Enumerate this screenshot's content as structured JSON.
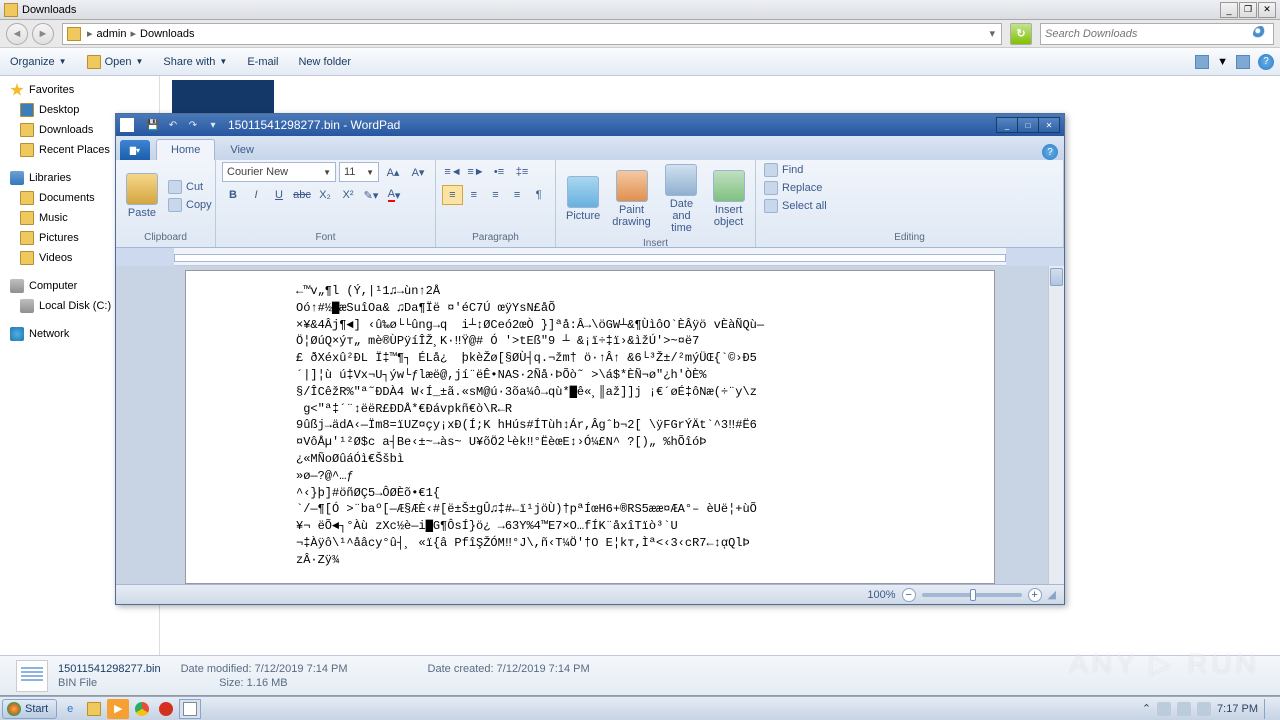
{
  "explorer": {
    "title": "Downloads",
    "breadcrumbs": [
      "admin",
      "Downloads"
    ],
    "search_placeholder": "Search Downloads",
    "toolbar": {
      "organize": "Organize",
      "open": "Open",
      "share": "Share with",
      "email": "E-mail",
      "newfolder": "New folder"
    },
    "sidebar": {
      "favorites": "Favorites",
      "desktop": "Desktop",
      "downloads": "Downloads",
      "recent": "Recent Places",
      "libraries": "Libraries",
      "documents": "Documents",
      "music": "Music",
      "pictures": "Pictures",
      "videos": "Videos",
      "computer": "Computer",
      "localdisk": "Local Disk (C:)",
      "network": "Network"
    },
    "details": {
      "filename": "15011541298277.bin",
      "filetype": "BIN File",
      "modified_label": "Date modified:",
      "modified": "7/12/2019 7:14 PM",
      "created_label": "Date created:",
      "created": "7/12/2019 7:14 PM",
      "size_label": "Size:",
      "size": "1.16 MB"
    }
  },
  "wordpad": {
    "title": "15011541298277.bin - WordPad",
    "tabs": {
      "home": "Home",
      "view": "View"
    },
    "ribbon": {
      "paste": "Paste",
      "cut": "Cut",
      "copy": "Copy",
      "clipboard": "Clipboard",
      "font_name": "Courier New",
      "font_size": "11",
      "font": "Font",
      "paragraph": "Paragraph",
      "picture": "Picture",
      "paint": "Paint drawing",
      "datetime": "Date and time",
      "insertobj": "Insert object",
      "insert": "Insert",
      "find": "Find",
      "replace": "Replace",
      "selectall": "Select all",
      "editing": "Editing"
    },
    "zoom": "100%",
    "body": "←™v„¶l (Ý,|¹1♫→ùn↑2Å\nOó↑#½▇æSuîOa& ♫Da¶Ïë ¤'éC7Ú œÿYsN£åÕ\n×¥&4Âj¶◄] ‹û‰ø└└ûng→q  i┴↕ØCeó2œÒ }]ªå:Â→\\öGW┴&¶ÙìôO`ÈÂÿö vÈàÑQù—\nÖ¦ØúQ×ýт„ mè®ÙPÿíÎŽ¸K·‼Ÿ@# Ó '>tEß\"9 ┴ &¡ï÷‡ï›&ìžÚ'>~¤ë7\n£ ðXéxû²ÐL Ï‡™¶┐ ÉLå¿  þkèŽø[§ØÙ┤q.¬žm† ö·↑Â↑ &6└³Ž±/²mýÜŒ{`©›Ð5\n´|]¦ù ú‡Vx¬U┐ýw└ƒlæë@,jí¨ëÊ•NAS·2Ñå·ÞÕò˜ >\\á$*ÈÑ¬ø\"¿h'ÒÈ%\n§/ÎCêžR%\"ª˜ÐDÀ4 W‹Í_±ã.«sM@ú·3õa¼ô→qù*▇ê«¸║až]]j ¡€´øÉ‡ôNæ(÷¨y\\z\n g<\"ª‡´¨↕ëëR£ÐDÅ*€Ðávpkñ€ò\\R←R\n9ûßj→ädA‹—Ïm8=ïUZ¤çy¡xÐ(Í;K hHús#ÍTùh↕Ár,Âgˆb¬2[ \\ÿFGrÝÄt`^3‼#Ë6\n¤VôÅµ'¹²Ø$c a┤Be‹±~→às~ U¥õÖ2└èk‼°ËèœE↕›Ó¼£N^ ?[)„ %hÕîóÞ\n¿«MÑoØûáÓì€Ššbì\n»ø—?@^…ƒ\n^‹}þ]#öñØÇ5→ÔØÈõ•€1{\n`/—¶[Ó >¨baº[—Æ§ÆÈ‹#[ë±Š±gÛ♫‡#←ï¹jöÙ)†pªÍœH6+®RS5ææ¤ÆA°– èUë¦+ùÕ\n¥¬ ëÕ◄┐°Àù zXc½è—i▇G¶ÔsÍ}ö¿ →63Y%4™E7×O…fÍK¨åxîTïò³`U\n¬‡Àÿô\\¹^åâcy°û┤¸ «ï{â PfîŞŽÓM‼°J\\,ñ‹T¼Ö'†O E¦kт,Ìª<‹3‹cR7←↕ᾳQlÞ\nzÂ·Zÿ¾"
  },
  "taskbar": {
    "start": "Start",
    "time": "7:17 PM"
  },
  "watermark": "ANY ▷ RUN"
}
